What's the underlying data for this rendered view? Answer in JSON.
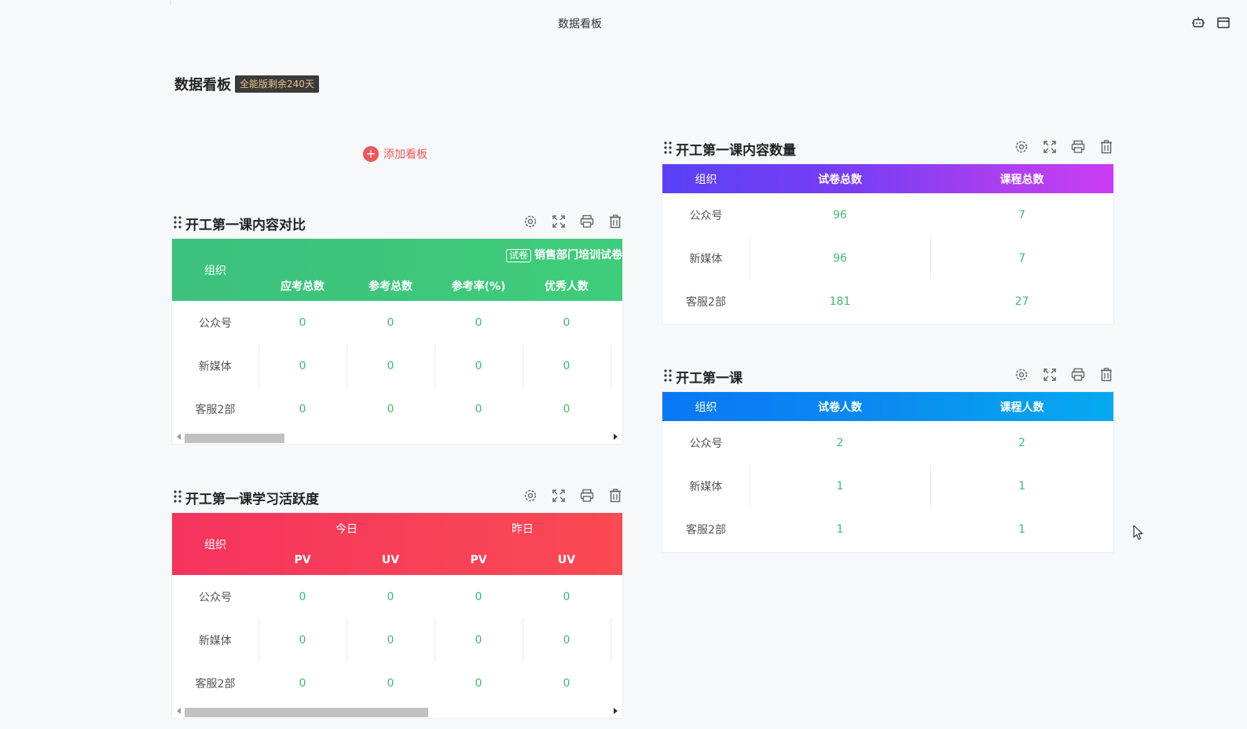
{
  "topbar": {
    "title": "数据看板",
    "icons": [
      "robot-icon",
      "window-icon"
    ]
  },
  "page": {
    "title": "数据看板",
    "badge": "全能版剩余240天",
    "add_board": "添加看板"
  },
  "widgets": {
    "compare": {
      "title": "开工第一课内容对比",
      "group_header": "销售部门培训试卷",
      "group_tag": "试卷",
      "columns": [
        "组织",
        "应考总数",
        "参考总数",
        "参考率(%)",
        "优秀人数"
      ],
      "rows": [
        [
          "公众号",
          "0",
          "0",
          "0",
          "0"
        ],
        [
          "新媒体",
          "0",
          "0",
          "0",
          "0"
        ],
        [
          "客服2部",
          "0",
          "0",
          "0",
          "0"
        ]
      ]
    },
    "activity": {
      "title": "开工第一课学习活跃度",
      "groups": [
        "今日",
        "昨日"
      ],
      "columns": [
        "组织",
        "PV",
        "UV",
        "PV",
        "UV"
      ],
      "rows": [
        [
          "公众号",
          "0",
          "0",
          "0",
          "0"
        ],
        [
          "新媒体",
          "0",
          "0",
          "0",
          "0"
        ],
        [
          "客服2部",
          "0",
          "0",
          "0",
          "0"
        ]
      ]
    },
    "content_count": {
      "title": "开工第一课内容数量",
      "columns": [
        "组织",
        "试卷总数",
        "课程总数"
      ],
      "rows": [
        [
          "公众号",
          "96",
          "7"
        ],
        [
          "新媒体",
          "96",
          "7"
        ],
        [
          "客服2部",
          "181",
          "27"
        ]
      ]
    },
    "course": {
      "title": "开工第一课",
      "columns": [
        "组织",
        "试卷人数",
        "课程人数"
      ],
      "rows": [
        [
          "公众号",
          "2",
          "2"
        ],
        [
          "新媒体",
          "1",
          "1"
        ],
        [
          "客服2部",
          "1",
          "1"
        ]
      ]
    }
  },
  "colors": {
    "accent_red": "#f0555a",
    "value_green": "#3cbd6e",
    "badge_text": "#e9c28a"
  }
}
